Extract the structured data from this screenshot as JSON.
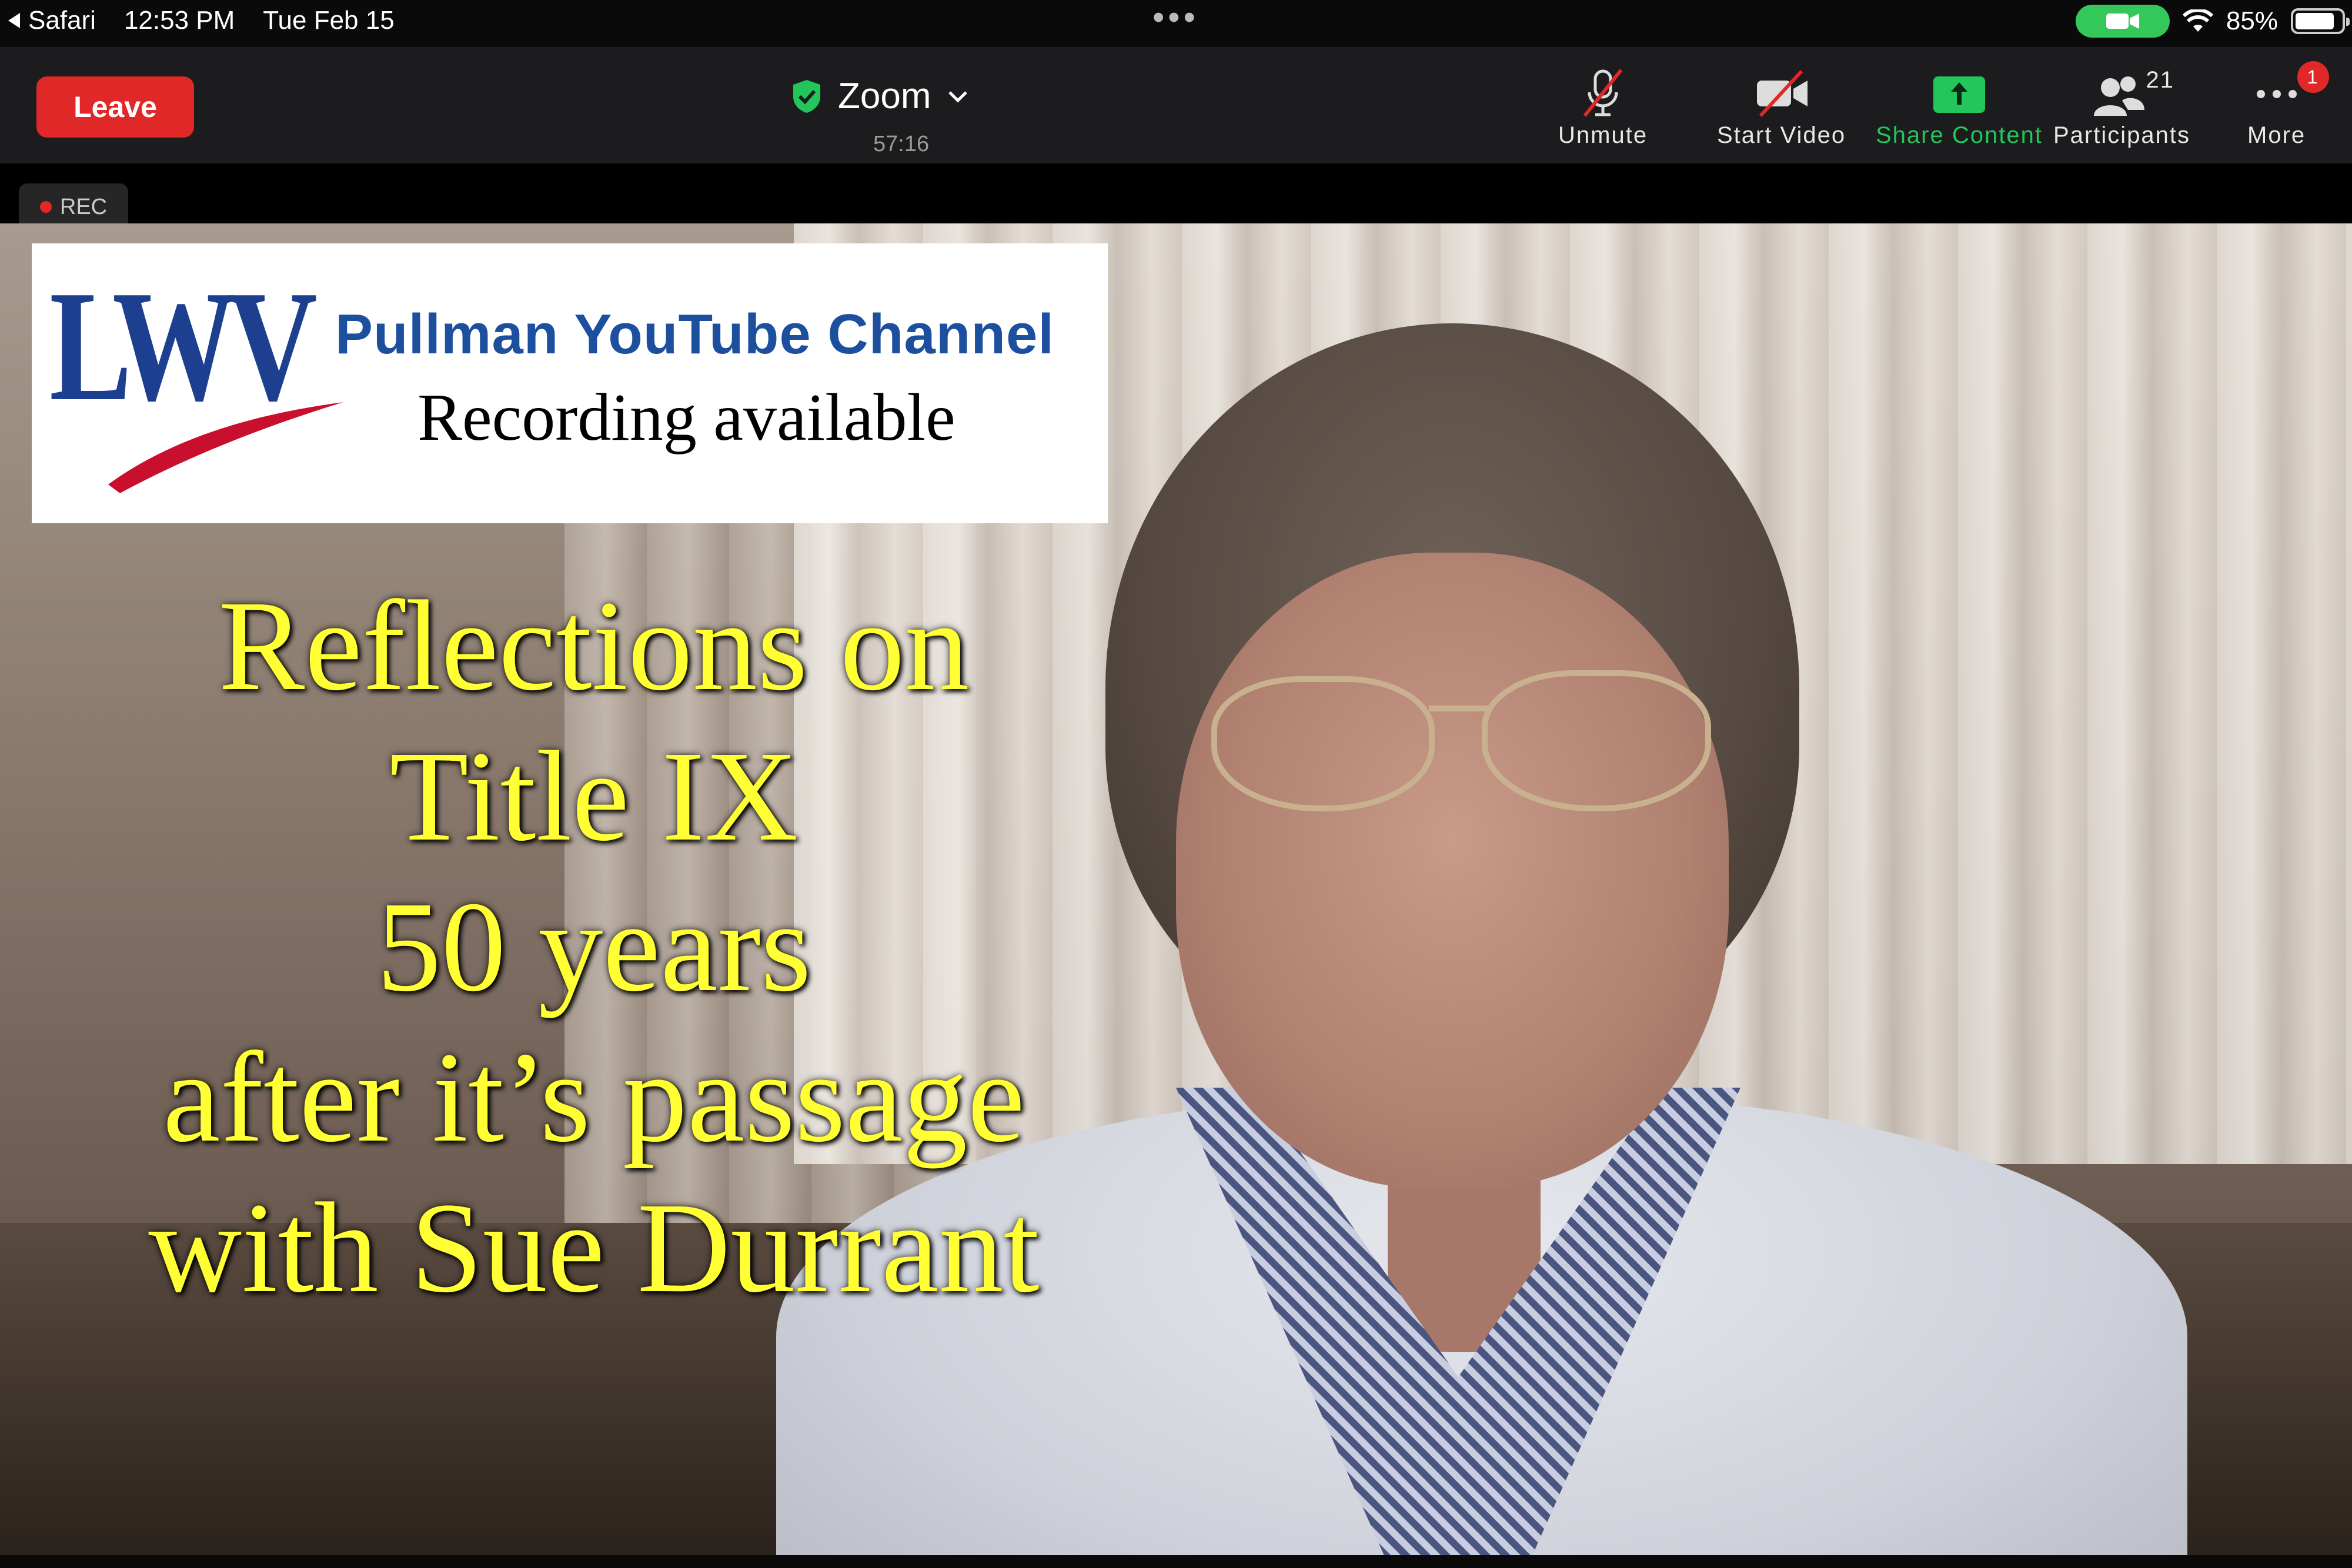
{
  "status_bar": {
    "back_app": "Safari",
    "time": "12:53 PM",
    "date": "Tue Feb 15",
    "battery": "85%",
    "battery_level": 0.85
  },
  "toolbar": {
    "leave_label": "Leave",
    "meeting_title": "Zoom",
    "timer": "57:16",
    "unmute_label": "Unmute",
    "start_video_label": "Start Video",
    "share_content_label": "Share Content",
    "participants_label": "Participants",
    "participants_count": "21",
    "more_label": "More",
    "more_badge": "1"
  },
  "recording_indicator": "REC",
  "banner": {
    "logo": "LWV",
    "channel_title": "Pullman YouTube Channel",
    "subtitle": "Recording available"
  },
  "overlay_title": {
    "line1": "Reflections on",
    "line2": "Title IX",
    "line3": "50 years",
    "line4": "after it’s passage",
    "line5": "with Sue Durrant"
  },
  "colors": {
    "leave_red": "#e02828",
    "share_green": "#23c65a",
    "overlay_yellow": "#ffff33",
    "lwv_blue": "#1d3f8f"
  },
  "icons": [
    "back-arrow-icon",
    "camera-icon",
    "wifi-icon",
    "battery-icon",
    "shield-check-icon",
    "chevron-down-icon",
    "mic-muted-icon",
    "video-off-icon",
    "share-up-arrow-icon",
    "participants-icon",
    "more-dots-icon"
  ]
}
